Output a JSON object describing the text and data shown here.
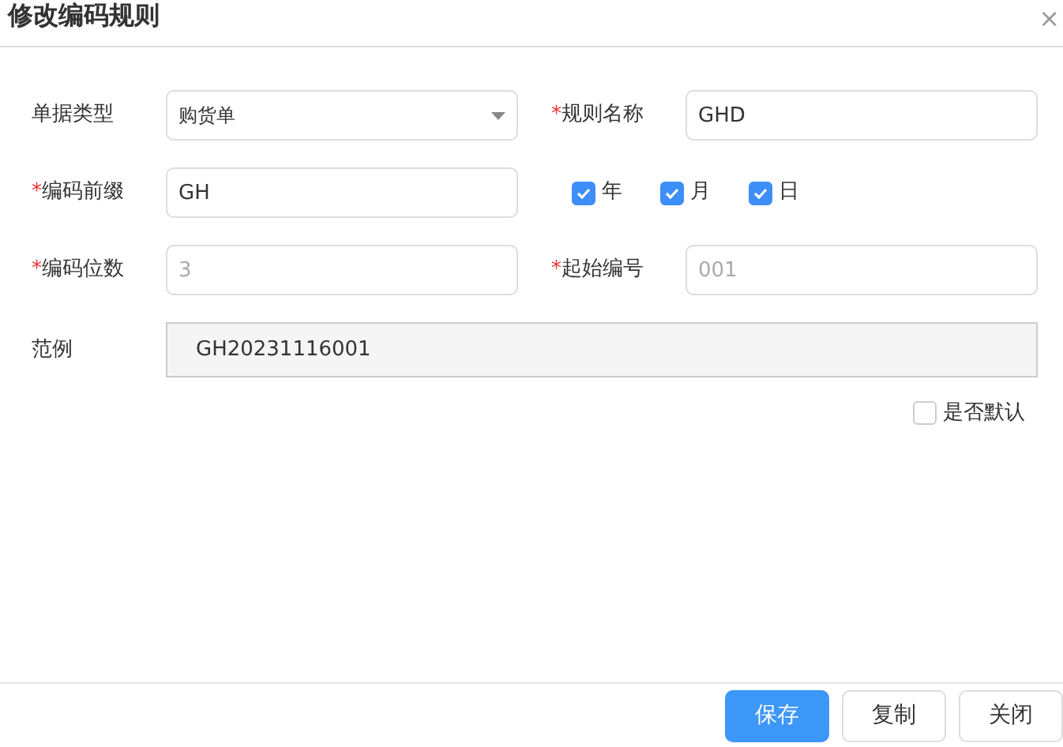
{
  "dialog": {
    "title": "修改编码规则",
    "close": "×"
  },
  "rows": [
    {
      "kind": "pair",
      "fields": [
        {
          "label": "单据类型",
          "kind": "select",
          "value": "购货单"
        },
        {
          "label": "规则名称",
          "required": "*",
          "kind": "input",
          "value": "GHD"
        }
      ]
    },
    {
      "kind": "prefix",
      "fields": [
        {
          "label": "编码前缀",
          "required": "*",
          "kind": "input",
          "value": "GH"
        }
      ],
      "checks": [
        {
          "label": "年",
          "checked": true
        },
        {
          "label": "月",
          "checked": true
        },
        {
          "label": "日",
          "checked": true
        }
      ]
    },
    {
      "kind": "pair",
      "fields": [
        {
          "label": "编码位数",
          "required": "*",
          "kind": "input",
          "placeholder": "3"
        },
        {
          "label": "起始编号",
          "required": "*",
          "kind": "input",
          "placeholder": "001"
        }
      ]
    },
    {
      "kind": "example",
      "label": "范例",
      "value": "GH20231116001"
    }
  ],
  "default_checkbox": {
    "label": "是否默认",
    "checked": false
  },
  "buttons": [
    {
      "label": "保存",
      "primary": true
    },
    {
      "label": "复制",
      "primary": false
    },
    {
      "label": "关闭",
      "primary": false
    }
  ]
}
